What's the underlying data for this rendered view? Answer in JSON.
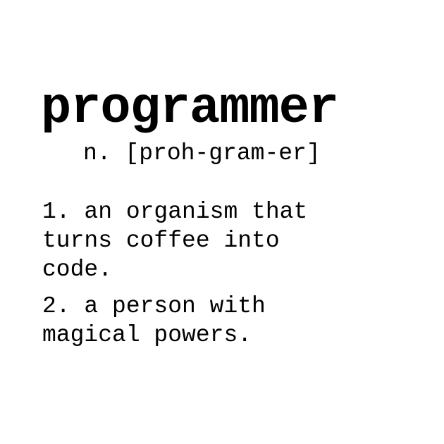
{
  "word": "programmer",
  "pronunciation": "n. [proh-gram-er]",
  "definitions": [
    "1. an organism that\nturns coffee into\ncode.",
    "2. a person with\nmagical powers."
  ]
}
